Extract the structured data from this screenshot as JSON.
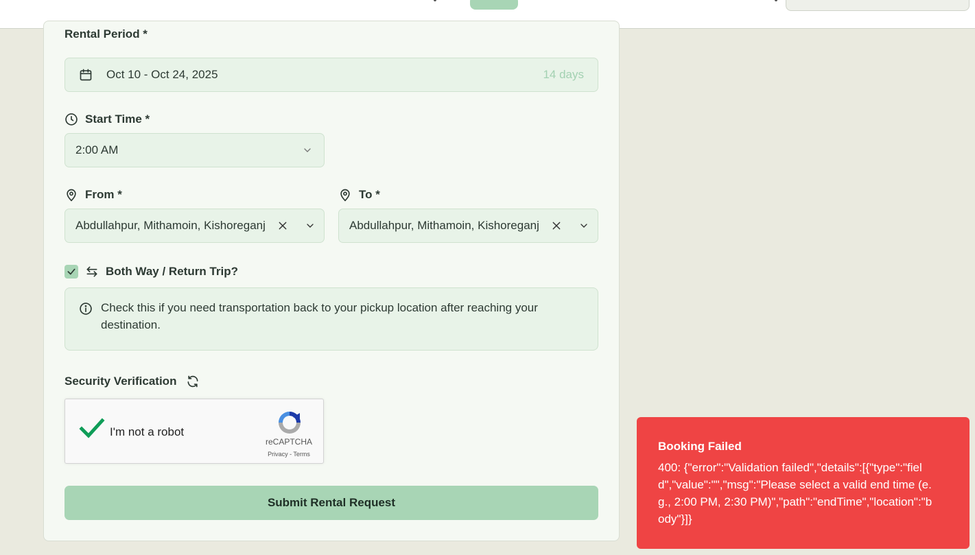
{
  "form": {
    "rental_period_label": "Rental Period *",
    "date_range": "Oct 10 - Oct 24, 2025",
    "duration": "14 days",
    "start_time_label": "Start Time *",
    "start_time_value": "2:00 AM",
    "from_label": "From *",
    "from_value": "Abdullahpur, Mithamoin, Kishoreganj",
    "to_label": "To *",
    "to_value": "Abdullahpur, Mithamoin, Kishoreganj",
    "both_way_label": "Both Way / Return Trip?",
    "both_way_checked": true,
    "info_text": "Check this if you need transportation back to your pickup location after reaching your destination.",
    "security_label": "Security Verification",
    "captcha_text": "I'm not a robot",
    "captcha_brand": "reCAPTCHA",
    "captcha_links": "Privacy - Terms",
    "submit_label": "Submit Rental Request"
  },
  "toast": {
    "title": "Booking Failed",
    "message": "400: {\"error\":\"Validation failed\",\"details\":[{\"type\":\"field\",\"value\":\"\",\"msg\":\"Please select a valid end time (e.g., 2:00 PM, 2:30 PM)\",\"path\":\"endTime\",\"location\":\"body\"}]}"
  },
  "colors": {
    "accent": "#a8d5b5",
    "error": "#ef4444",
    "background": "#eaeadf"
  }
}
